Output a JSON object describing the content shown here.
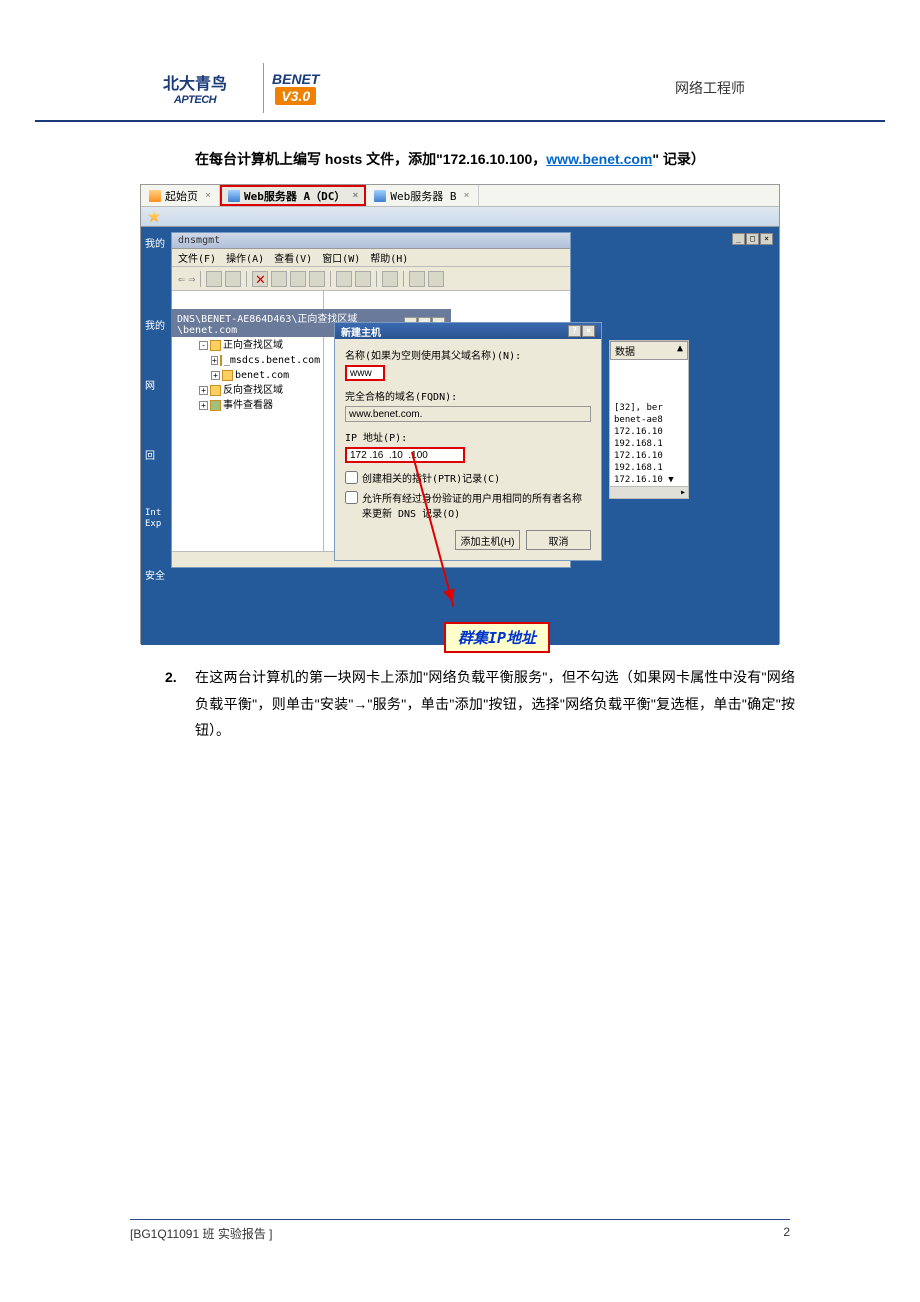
{
  "header": {
    "logo_line1": "北大青鸟",
    "logo_line2": "APTECH",
    "benet_name": "BENET",
    "benet_version": "V3.0",
    "title": "网络工程师"
  },
  "instruction": {
    "pre": "在每台计算机上编写 hosts 文件，添加\"",
    "ip": "172.16.10.100，",
    "link": "www.benet.com",
    "post": "\" 记录）"
  },
  "tabs": {
    "start": "起始页",
    "wsa": "Web服务器 A（DC）",
    "wsb": "Web服务器 B"
  },
  "win1": {
    "appname": "dnsmgmt",
    "menu_file": "文件(F)",
    "menu_action": "操作(A)",
    "menu_view": "查看(V)",
    "menu_window": "窗口(W)",
    "menu_help": "帮助(H)",
    "path": "DNS\\BENET-AE864D463\\正向查找区域\\benet.com"
  },
  "tree": {
    "root": "DNS",
    "server": "BENET-AE864D463",
    "fwd": "正向查找区域",
    "msdcs": "_msdcs.benet.com",
    "benet": "benet.com",
    "rev": "反向查找区域",
    "event": "事件查看器"
  },
  "dialog": {
    "title": "新建主机",
    "label_name": "名称(如果为空则使用其父域名称)(N):",
    "value_name": "www",
    "label_fqdn": "完全合格的域名(FQDN):",
    "value_fqdn": "www.benet.com.",
    "label_ip": "IP 地址(P):",
    "value_ip": "172 .16  .10  .100",
    "check_ptr": "创建相关的指针(PTR)记录(C)",
    "check_dns": "允许所有经过身份验证的用户用相同的所有者名称来更新 DNS 记录(O)",
    "btn_add": "添加主机(H)",
    "btn_cancel": "取消"
  },
  "rightpane": {
    "header": "数据",
    "r1": "[32], ber",
    "r2": "benet-ae8",
    "r3": "172.16.10",
    "r4": "192.168.1",
    "r5": "172.16.10",
    "r6": "192.168.1",
    "r7": "172.16.10"
  },
  "callout": "群集IP地址",
  "desktop": {
    "d1": "我的",
    "d2": "我的",
    "d3": "网",
    "d4": "回",
    "d5a": "Int",
    "d5b": "Exp",
    "d6": "安全"
  },
  "para2": {
    "num": "2.",
    "text": "在这两台计算机的第一块网卡上添加\"网络负载平衡服务\"，但不勾选（如果网卡属性中没有\"网络负载平衡\"，则单击\"安装\"→\"服务\"，单击\"添加\"按钮，选择\"网络负载平衡\"复选框，单击\"确定\"按钮）。"
  },
  "footer": {
    "left": "[BG1Q11091 班    实验报告 ]",
    "right": "2"
  }
}
